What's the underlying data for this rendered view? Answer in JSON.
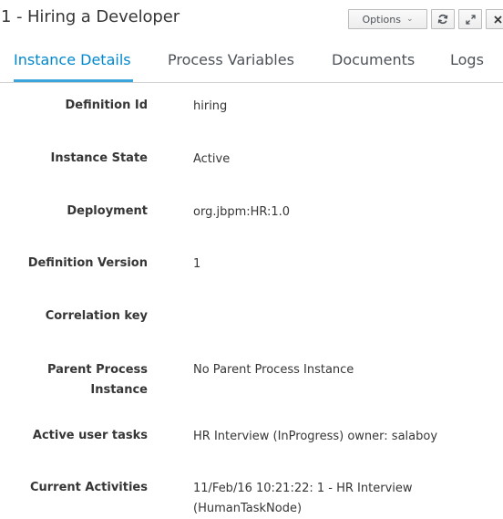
{
  "header": {
    "title": "1 - Hiring a Developer",
    "options_label": "Options",
    "refresh_icon": "refresh-icon",
    "expand_icon": "expand-icon",
    "close_icon": "close-icon"
  },
  "tabs": [
    {
      "label": "Instance Details",
      "active": true
    },
    {
      "label": "Process Variables",
      "active": false
    },
    {
      "label": "Documents",
      "active": false
    },
    {
      "label": "Logs",
      "active": false
    }
  ],
  "details": [
    {
      "label": "Definition Id",
      "value": "hiring"
    },
    {
      "label": "Instance State",
      "value": "Active"
    },
    {
      "label": "Deployment",
      "value": "org.jbpm:HR:1.0"
    },
    {
      "label": "Definition Version",
      "value": "1"
    },
    {
      "label": "Correlation key",
      "value": ""
    },
    {
      "label": "Parent Process Instance",
      "value": "No Parent Process Instance"
    },
    {
      "label": "Active user tasks",
      "value": "HR Interview (InProgress) owner: salaboy"
    },
    {
      "label": "Current Activities",
      "value": "11/Feb/16 10:21:22: 1 - HR Interview (HumanTaskNode)"
    }
  ],
  "colors": {
    "accent": "#0088ce",
    "tab_underline": "#39a5dc",
    "text": "#363636"
  }
}
